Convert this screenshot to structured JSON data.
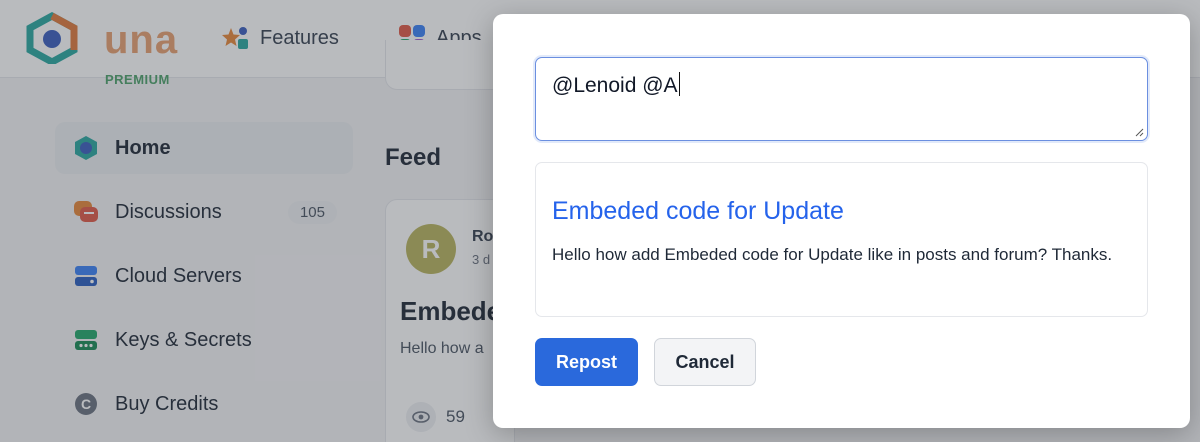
{
  "brand": {
    "name": "una",
    "tier": "PREMIUM"
  },
  "nav": [
    {
      "label": "Features"
    },
    {
      "label": "Apps"
    }
  ],
  "sidebar": {
    "items": [
      {
        "label": "Home",
        "icon": "home-icon"
      },
      {
        "label": "Discussions",
        "icon": "discussions-icon",
        "count": "105"
      },
      {
        "label": "Cloud Servers",
        "icon": "cloud-servers-icon"
      },
      {
        "label": "Keys & Secrets",
        "icon": "keys-icon"
      },
      {
        "label": "Buy Credits",
        "icon": "credits-icon"
      }
    ]
  },
  "feed": {
    "title": "Feed",
    "post": {
      "avatar_letter": "R",
      "author": "Ro",
      "date": "3 d",
      "title": "Embede",
      "snippet": "Hello how a",
      "views": "59"
    }
  },
  "modal": {
    "input_value": "@Lenoid @A",
    "embed": {
      "title": "Embeded code for Update",
      "text": "Hello how add Embeded code for Update like in posts and forum? Thanks."
    },
    "repost_label": "Repost",
    "cancel_label": "Cancel"
  },
  "colors": {
    "accent": "#2a69dc",
    "link": "#2563eb",
    "premium": "#4ea26a",
    "brand_orange": "#e8a070",
    "brand_teal": "#2aa8a0"
  }
}
